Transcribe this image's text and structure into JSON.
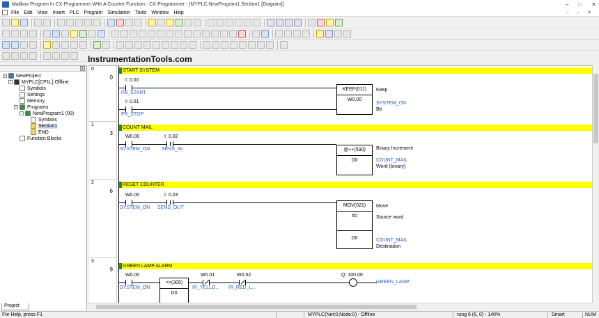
{
  "window": {
    "title": "Mailbox Program In CX-Programmer With A Counter Function - CX-Programmer - [MYPLC.NewProgram1.Section1 [Diagram]]",
    "minimize": "–",
    "maximize": "□",
    "close": "✕"
  },
  "menu": [
    "File",
    "Edit",
    "View",
    "Insert",
    "PLC",
    "Program",
    "Simulation",
    "Tools",
    "Window",
    "Help"
  ],
  "mdi_controls": "– ▫ ✕",
  "brand": "InstrumentationTools.com",
  "tree": {
    "close": "x",
    "root": "NewProject",
    "plc": "MYPLC[CP1L] Offline",
    "symbols": "Symbols",
    "settings": "Settings",
    "memory": "Memory",
    "programs": "Programs",
    "program": "NewProgram1 (00)",
    "prog_symbols": "Symbols",
    "section": "Section1",
    "end": "END",
    "function_blocks": "Function Blocks",
    "tab": "Project"
  },
  "rungs": [
    {
      "number": "0",
      "step": "0",
      "comment": "START SYSTEM",
      "c1_addr": "I: 0.00",
      "c1_name": "PB_START",
      "c2_addr": "I: 0.01",
      "c2_name": "PB_STOP",
      "fb": "KEEP(011)",
      "op": "W0.00",
      "out1": "Keep",
      "out2": "SYSTEM_ON",
      "out3": "Bit"
    },
    {
      "number": "1",
      "step": "3",
      "comment": "COUNT MAIL",
      "c1_addr": "W0.00",
      "c1_name": "SYSTEM_ON",
      "c2_addr": "I: 0.02",
      "c2_name": "SENS_IN",
      "fb": "@++(590)",
      "op": "D0",
      "out1": "Binary Increment",
      "out2": "COUNT_MAIL",
      "out3": "Word (binary)"
    },
    {
      "number": "2",
      "step": "6",
      "comment": "RESET COUNTER",
      "c1_addr": "W0.00",
      "c1_name": "SYSTEM_ON",
      "c2_addr": "I: 0.03",
      "c2_name": "SENS_OUT",
      "fb": "MOV(021)",
      "op1": "#0",
      "op2": "D0",
      "out1": "Move",
      "out2": "Source word",
      "out3": "COUNT_MAIL",
      "out4": "Destination"
    },
    {
      "number": "3",
      "step": "9",
      "comment": "GREEN LAMP ALARM",
      "c1_addr": "W0.00",
      "c1_name": "SYSTEM_ON",
      "fb": "<>(305)",
      "op": "D0",
      "c2_addr": "W0.01",
      "c2_name": "IR_YELLO...",
      "c3_addr": "W0.02",
      "c3_name": "IR_RED_L...",
      "coil_addr": "Q: 100.00",
      "coil_name": "GREEN_LAMP"
    }
  ],
  "status": {
    "help": "For Help, press F1",
    "plc": "MYPLC(Net:0,Node:0) - Offline",
    "rung": "rung 6 (6, 0)  - 140%",
    "smart": "Smart",
    "num": "NUM"
  }
}
